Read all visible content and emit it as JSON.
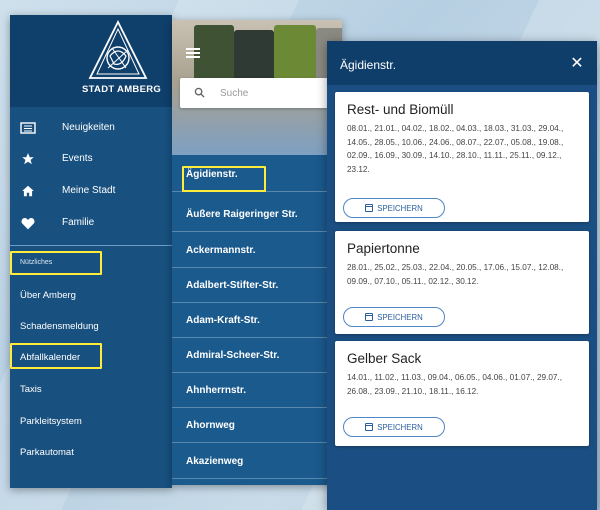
{
  "colors": {
    "dark_blue": "#0f3f6b",
    "blue": "#18507f",
    "highlight": "#ffeb3b"
  },
  "menu_app": {
    "city_name": "STADT AMBERG",
    "items": [
      {
        "label": "Neuigkeiten",
        "icon": "newspaper-icon"
      },
      {
        "label": "Events",
        "icon": "star-icon"
      },
      {
        "label": "Meine Stadt",
        "icon": "home-icon"
      },
      {
        "label": "Familie",
        "icon": "heart-icon"
      }
    ],
    "section_label": "Nützliches",
    "links": [
      "Über Amberg",
      "Schadensmeldung",
      "Abfallkalender",
      "Taxis",
      "Parkleitsystem",
      "Parkautomat"
    ]
  },
  "street_list": {
    "search_placeholder": "Suche",
    "streets": [
      "Ägidienstr.",
      "Äußere Raigeringer Str.",
      "Ackermannstr.",
      "Adalbert-Stifter-Str.",
      "Adam-Kraft-Str.",
      "Admiral-Scheer-Str.",
      "Ahnherrnstr.",
      "Ahornweg",
      "Akazienweg"
    ]
  },
  "dates_dialog": {
    "title": "Ägidienstr.",
    "close_icon": "close-icon",
    "cards": [
      {
        "title": "Rest- und Biomüll",
        "dates": "08.01., 21.01., 04.02., 18.02., 04.03., 18.03., 31.03., 29.04., 14.05., 28.05., 10.06., 24.06., 08.07., 22.07., 05.08., 19.08., 02.09., 16.09., 30.09., 14.10., 28.10., 11.11., 25.11., 09.12., 23.12.",
        "button": "SPEICHERN"
      },
      {
        "title": "Papiertonne",
        "dates": "28.01., 25.02., 25.03., 22.04., 20.05., 17.06., 15.07., 12.08., 09.09., 07.10., 05.11., 02.12., 30.12.",
        "button": "SPEICHERN"
      },
      {
        "title": "Gelber Sack",
        "dates": "14.01., 11.02., 11.03., 09.04., 06.05., 04.06., 01.07., 29.07., 26.08., 23.09., 21.10., 18.11., 16.12.",
        "button": "SPEICHERN"
      }
    ]
  }
}
